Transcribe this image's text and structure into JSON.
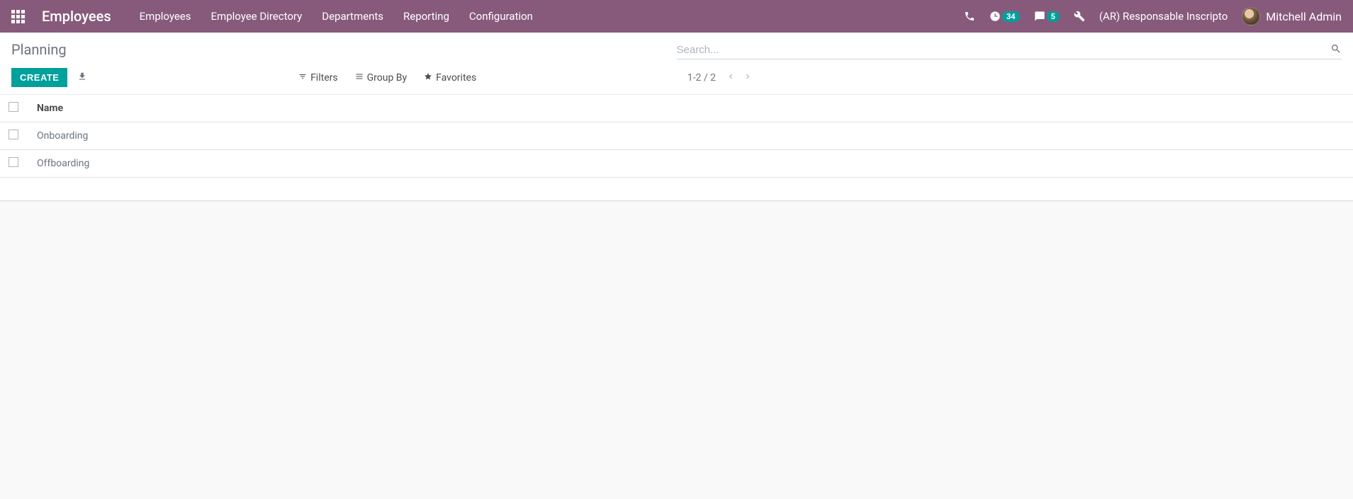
{
  "navbar": {
    "brand": "Employees",
    "menu": [
      "Employees",
      "Employee Directory",
      "Departments",
      "Reporting",
      "Configuration"
    ],
    "activity_badge": "34",
    "message_badge": "5",
    "company": "(AR) Responsable Inscripto",
    "user": "Mitchell Admin"
  },
  "breadcrumb": "Planning",
  "search": {
    "placeholder": "Search..."
  },
  "buttons": {
    "create": "CREATE"
  },
  "search_options": {
    "filters": "Filters",
    "groupby": "Group By",
    "favorites": "Favorites"
  },
  "pager": "1-2 / 2",
  "table": {
    "header": "Name",
    "rows": [
      "Onboarding",
      "Offboarding"
    ]
  }
}
